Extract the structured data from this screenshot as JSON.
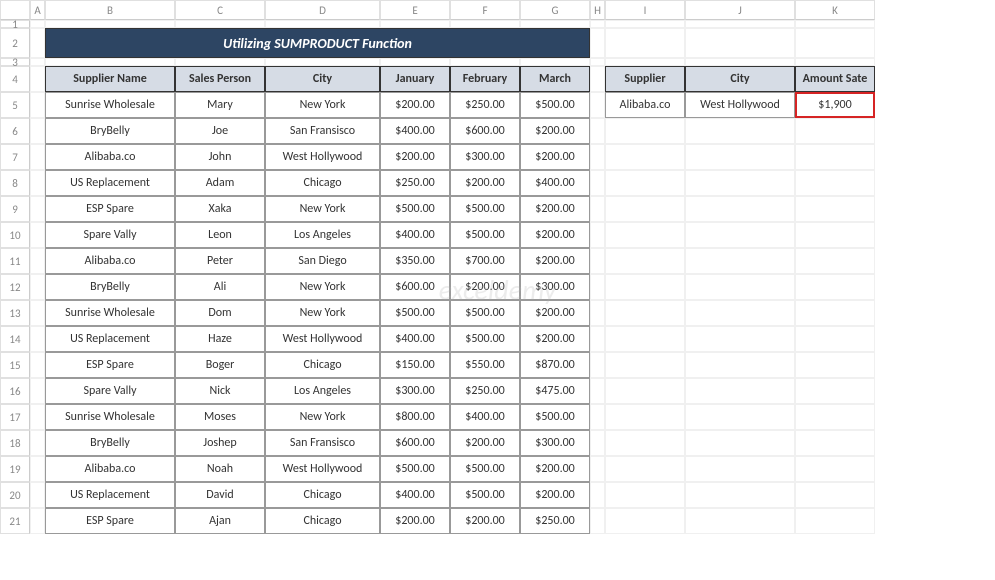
{
  "title": "Utilizing SUMPRODUCT Function",
  "columns_letters": [
    "A",
    "B",
    "C",
    "D",
    "E",
    "F",
    "G",
    "H",
    "I",
    "J",
    "K"
  ],
  "table": {
    "headers": [
      "Supplier Name",
      "Sales Person",
      "City",
      "January",
      "February",
      "March"
    ],
    "rows": [
      [
        "Sunrise Wholesale",
        "Mary",
        "New York",
        "$200.00",
        "$250.00",
        "$500.00"
      ],
      [
        "BryBelly",
        "Joe",
        "San Fransisco",
        "$400.00",
        "$600.00",
        "$200.00"
      ],
      [
        "Alibaba.co",
        "John",
        "West Hollywood",
        "$200.00",
        "$300.00",
        "$200.00"
      ],
      [
        "US Replacement",
        "Adam",
        "Chicago",
        "$250.00",
        "$200.00",
        "$400.00"
      ],
      [
        "ESP Spare",
        "Xaka",
        "New York",
        "$500.00",
        "$500.00",
        "$200.00"
      ],
      [
        "Spare Vally",
        "Leon",
        "Los Angeles",
        "$400.00",
        "$500.00",
        "$200.00"
      ],
      [
        "Alibaba.co",
        "Peter",
        "San Diego",
        "$350.00",
        "$700.00",
        "$200.00"
      ],
      [
        "BryBelly",
        "Ali",
        "New York",
        "$600.00",
        "$200.00",
        "$300.00"
      ],
      [
        "Sunrise Wholesale",
        "Dom",
        "New York",
        "$500.00",
        "$500.00",
        "$200.00"
      ],
      [
        "US Replacement",
        "Haze",
        "West Hollywood",
        "$400.00",
        "$500.00",
        "$200.00"
      ],
      [
        "ESP Spare",
        "Boger",
        "Chicago",
        "$150.00",
        "$550.00",
        "$870.00"
      ],
      [
        "Spare Vally",
        "Nick",
        "Los Angeles",
        "$300.00",
        "$250.00",
        "$475.00"
      ],
      [
        "Sunrise Wholesale",
        "Moses",
        "New York",
        "$800.00",
        "$400.00",
        "$500.00"
      ],
      [
        "BryBelly",
        "Joshep",
        "San Fransisco",
        "$600.00",
        "$200.00",
        "$300.00"
      ],
      [
        "Alibaba.co",
        "Noah",
        "West Hollywood",
        "$500.00",
        "$500.00",
        "$200.00"
      ],
      [
        "US Replacement",
        "David",
        "Chicago",
        "$400.00",
        "$500.00",
        "$200.00"
      ],
      [
        "ESP Spare",
        "Ajan",
        "Chicago",
        "$200.00",
        "$200.00",
        "$250.00"
      ]
    ]
  },
  "lookup": {
    "headers": [
      "Supplier",
      "City",
      "Amount Sate"
    ],
    "values": [
      "Alibaba.co",
      "West Hollywood",
      "$1,900"
    ]
  },
  "watermark": "exceldemy"
}
